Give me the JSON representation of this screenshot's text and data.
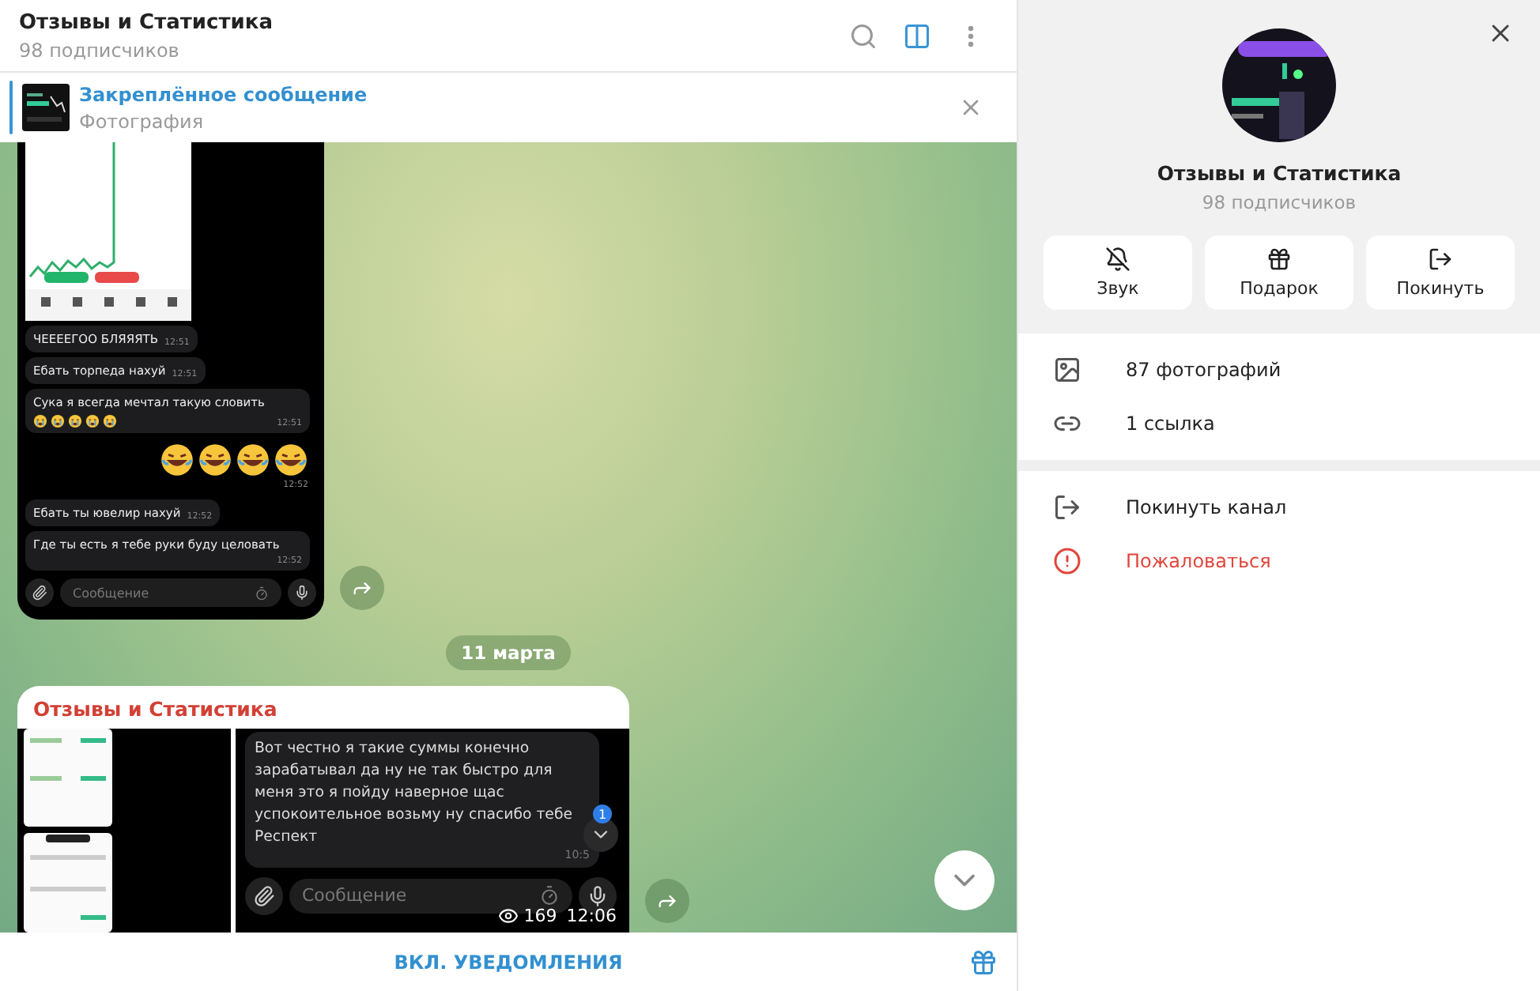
{
  "header": {
    "title": "Отзывы и Статистика",
    "subtitle": "98 подписчиков"
  },
  "pinned": {
    "title": "Закреплённое сообщение",
    "subtitle": "Фотография"
  },
  "first_message": {
    "chat": [
      {
        "text": "ЧЕЕЕЕГОО БЛЯЯЯТЬ",
        "time": "12:51",
        "kind": "text"
      },
      {
        "text": "Ебать торпеда нахуй",
        "time": "12:51",
        "kind": "text"
      },
      {
        "text": "Сука я всегда мечтал такую словить",
        "time": "12:51",
        "kind": "crying"
      },
      {
        "time": "12:52",
        "kind": "laughing"
      },
      {
        "text": "Ебать ты ювелир нахуй",
        "time": "12:52",
        "kind": "text"
      },
      {
        "text": "Где ты есть я тебе руки буду целовать",
        "time": "12:52",
        "kind": "text"
      }
    ],
    "input_placeholder": "Сообщение"
  },
  "date_pill": "11 марта",
  "post": {
    "author": "Отзывы и Статистика",
    "screenshot_text": "Вот честно я такие суммы конечно зарабатывал да ну не так быстро для меня это я пойду наверное щас успокоительное возьму ну спасибо тебе Респект",
    "screenshot_time": "10:5",
    "unread_badge": "1",
    "input_placeholder": "Сообщение",
    "views": "169",
    "time": "12:06"
  },
  "bottom_action": "ВКЛ. УВЕДОМЛЕНИЯ",
  "panel": {
    "title": "Отзывы и Статистика",
    "subtitle": "98 подписчиков",
    "buttons": [
      {
        "kind": "mute",
        "label": "Звук"
      },
      {
        "kind": "gift",
        "label": "Подарок"
      },
      {
        "kind": "leave",
        "label": "Покинуть"
      }
    ],
    "info": [
      {
        "kind": "photos",
        "label": "87 фотографий"
      },
      {
        "kind": "link",
        "label": "1 ссылка"
      }
    ],
    "actions": [
      {
        "kind": "leave",
        "label": "Покинуть канал"
      },
      {
        "kind": "report",
        "label": "Пожаловаться"
      }
    ]
  }
}
